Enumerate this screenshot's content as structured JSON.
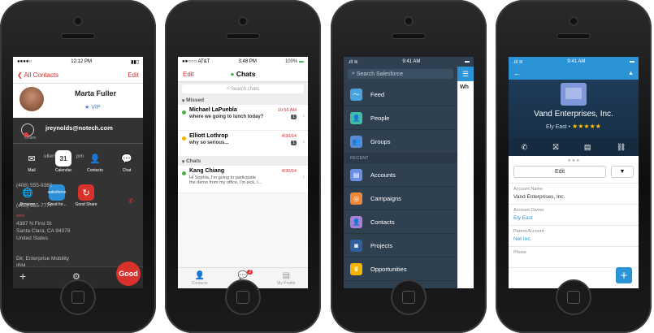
{
  "phone1": {
    "status": {
      "carrier": "●●●●○",
      "time": "12:12 PM"
    },
    "nav": {
      "back": "All Contacts",
      "edit": "Edit"
    },
    "contact": {
      "name": "Marta Fuller",
      "badge": "VIP"
    },
    "account": {
      "email": "jreynolds@notech.com",
      "status": "Online"
    },
    "partial": {
      "l1": "ullers",
      "l2": "pm"
    },
    "apps_row1": [
      {
        "label": "Mail",
        "icon": "mail-icon",
        "glyph": "✉"
      },
      {
        "label": "Calendar",
        "icon": "calendar-icon",
        "glyph": "31"
      },
      {
        "label": "Contacts",
        "icon": "contacts-icon",
        "glyph": "👤"
      },
      {
        "label": "Chat",
        "icon": "chat-icon",
        "glyph": "💬"
      }
    ],
    "apps_row2": [
      {
        "label": "Browser",
        "icon": "globe-icon",
        "glyph": "🌐"
      },
      {
        "label": "Good for...",
        "icon": "salesforce-icon",
        "glyph": "salesforce"
      },
      {
        "label": "Good Share",
        "icon": "good-share-icon",
        "glyph": "↻"
      }
    ],
    "bg_text": {
      "phone1": "(408) 555-9365",
      "phone2": "(408) 555-7777",
      "addr_label": "work",
      "addr1": "4387 N First St",
      "addr2": "Santa Clara, CA 94078",
      "addr3": "United States",
      "title": "Dir, Enterprise Mobility",
      "company": "IBM"
    },
    "good_button": "Good"
  },
  "phone2": {
    "status": {
      "carrier": "●●○○○ AT&T",
      "time": "3:48 PM",
      "battery": "100%"
    },
    "nav": {
      "edit": "Edit",
      "title": "Chats"
    },
    "search_placeholder": "Search chats",
    "sections": {
      "missed": "Missed",
      "chats": "Chats"
    },
    "missed": [
      {
        "name": "Michael LaPuebla",
        "time": "10:56 AM",
        "msg": "where we going to lunch today?",
        "count": "1",
        "dot": "#4caf50"
      },
      {
        "name": "Elliott Lothrop",
        "time": "4/30/14",
        "msg": "why so serious...",
        "count": "1",
        "dot": "#f4b400"
      }
    ],
    "chats": [
      {
        "name": "Kang Chiang",
        "time": "4/30/14",
        "msg1": "Hi Sophia, I'm going to participate",
        "msg2": "the demo from my office, I'm sick, I...",
        "dot": "#4caf50"
      }
    ],
    "tabs": [
      {
        "label": "Contacts",
        "icon": "contacts-tab-icon"
      },
      {
        "label": "Chats",
        "icon": "chats-tab-icon",
        "badge": "2"
      },
      {
        "label": "My Profile",
        "icon": "profile-tab-icon"
      }
    ]
  },
  "phone3": {
    "status": {
      "time": "9:41 AM"
    },
    "search_placeholder": "Search Salesforce",
    "peek": "Wh",
    "items_top": [
      {
        "label": "Feed",
        "icon": "feed-icon",
        "color": "#4aa3df",
        "glyph": "〜"
      },
      {
        "label": "People",
        "icon": "people-icon",
        "color": "#3ebfa5",
        "glyph": "👤"
      },
      {
        "label": "Groups",
        "icon": "groups-icon",
        "color": "#5b8ad6",
        "glyph": "👥"
      }
    ],
    "recent_label": "RECENT",
    "items_recent": [
      {
        "label": "Accounts",
        "icon": "accounts-icon",
        "color": "#6c8ee5",
        "glyph": "▤"
      },
      {
        "label": "Campaigns",
        "icon": "campaigns-icon",
        "color": "#f0883a",
        "glyph": "◎"
      },
      {
        "label": "Contacts",
        "icon": "contacts-icon",
        "color": "#a77fd6",
        "glyph": "👤"
      },
      {
        "label": "Projects",
        "icon": "projects-icon",
        "color": "#2e5f9e",
        "glyph": "◙"
      },
      {
        "label": "Opportunities",
        "icon": "opportunities-icon",
        "color": "#f4b400",
        "glyph": "♛"
      }
    ]
  },
  "phone4": {
    "status": {
      "time": "9:41 AM"
    },
    "account_name": "Vand Enterprises, Inc.",
    "owner_line": "Ely East",
    "rating": "★★★★★",
    "edit": "Edit",
    "fields": [
      {
        "label": "Account Name",
        "value": "Vand Enterprises, Inc.",
        "link": false
      },
      {
        "label": "Account Owner",
        "value": "Ely East",
        "link": true
      },
      {
        "label": "Parent Account",
        "value": "Net Inc.",
        "link": true
      },
      {
        "label": "Phone",
        "value": "",
        "link": false
      }
    ],
    "fab": "+",
    "colors": {
      "header": "#2a94d6",
      "hero": "#1e3a57",
      "link": "#2a94d6"
    }
  }
}
